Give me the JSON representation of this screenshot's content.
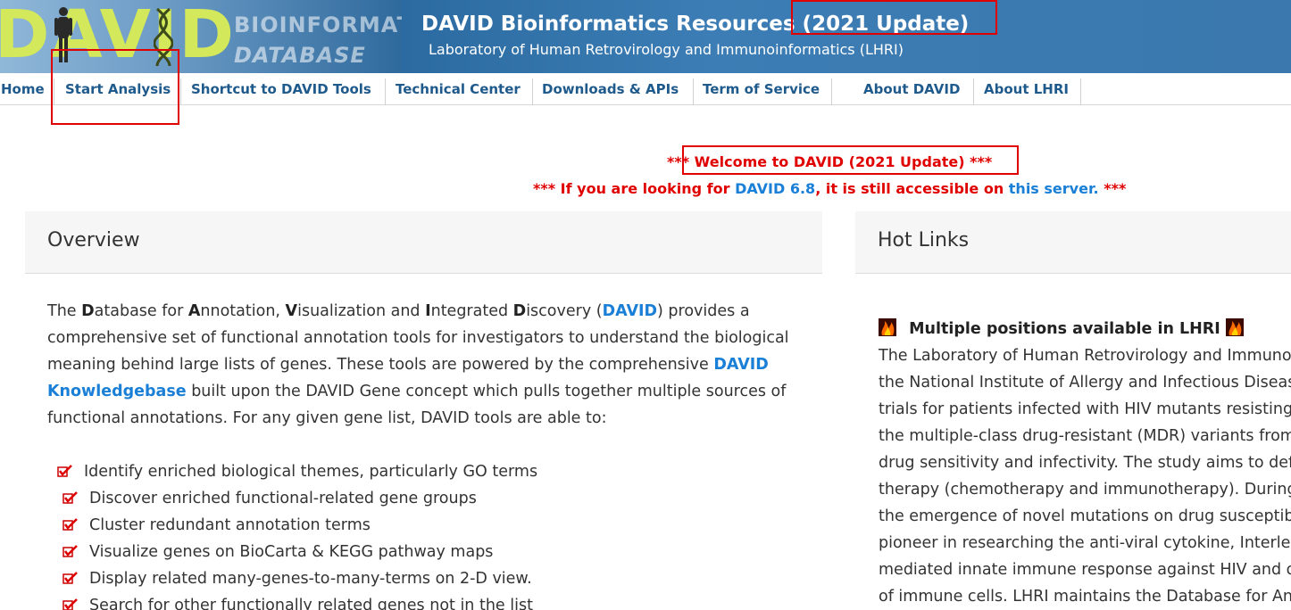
{
  "banner": {
    "logo_letters": "DAVID",
    "logo_sub1": "BIOINFORMATICS",
    "logo_sub2": "DATABASE",
    "title": "DAVID Bioinformatics Resources (2021 Update)",
    "subtitle": "Laboratory of Human Retrovirology and Immunoinformatics (LHRI)"
  },
  "nav": {
    "items": [
      "Home",
      "Start Analysis",
      "Shortcut to DAVID Tools",
      "Technical Center",
      "Downloads & APIs",
      "Term of Service",
      "About DAVID",
      "About LHRI"
    ]
  },
  "welcome": {
    "line1": "*** Welcome to DAVID (2021 Update) ***",
    "line2_prefix": "*** If you are looking for ",
    "line2_link1": "DAVID 6.8",
    "line2_middle": ", it is still accessible on ",
    "line2_link2": "this server.",
    "line2_suffix": " ***"
  },
  "overview": {
    "heading": "Overview",
    "p1": "The ",
    "D1": "D",
    "p2": "atabase for ",
    "A1": "A",
    "p3": "nnotation, ",
    "V1": "V",
    "p4": "isualization and ",
    "I1": "I",
    "p5": "ntegrated ",
    "D2": "D",
    "p6": "iscovery (",
    "link_david": "DAVID",
    "p7": ") provides a comprehensive set of functional annotation tools for investigators to understand the biological meaning behind large lists of genes. These tools are powered by the comprehensive ",
    "link_kb": "DAVID Knowledgebase",
    "p8": " built upon the DAVID Gene concept which pulls together multiple sources of functional annotations. For any given gene list, DAVID tools are able to:",
    "features": [
      "Identify enriched biological themes, particularly GO terms",
      "Discover enriched functional-related gene groups",
      "Cluster redundant annotation terms",
      "Visualize genes on BioCarta & KEGG pathway maps",
      "Display related many-genes-to-many-terms on 2-D view.",
      "Search for other functionally related genes not in the list"
    ]
  },
  "hotlinks": {
    "heading": "Hot Links",
    "item_title": "Multiple positions available in LHRI",
    "lines": [
      "The Laboratory of Human Retrovirology and Immuno",
      "the National Institute of Allergy and Infectious Diseas",
      "trials for patients infected with HIV mutants resisting",
      "the multiple-class drug-resistant (MDR) variants from",
      "drug sensitivity and infectivity. The study aims to def",
      "therapy (chemotherapy and immunotherapy). During",
      "the emergence of novel mutations on drug susceptib",
      "pioneer in researching the anti-viral cytokine, Interleu",
      "mediated innate immune response against HIV and o",
      "of immune cells. LHRI maintains the Database for An"
    ]
  },
  "colors": {
    "nav_text": "#1f5a8c",
    "link": "#1a7fd6",
    "alert_red": "#e00000",
    "logo_yellow": "#d3e85a"
  }
}
